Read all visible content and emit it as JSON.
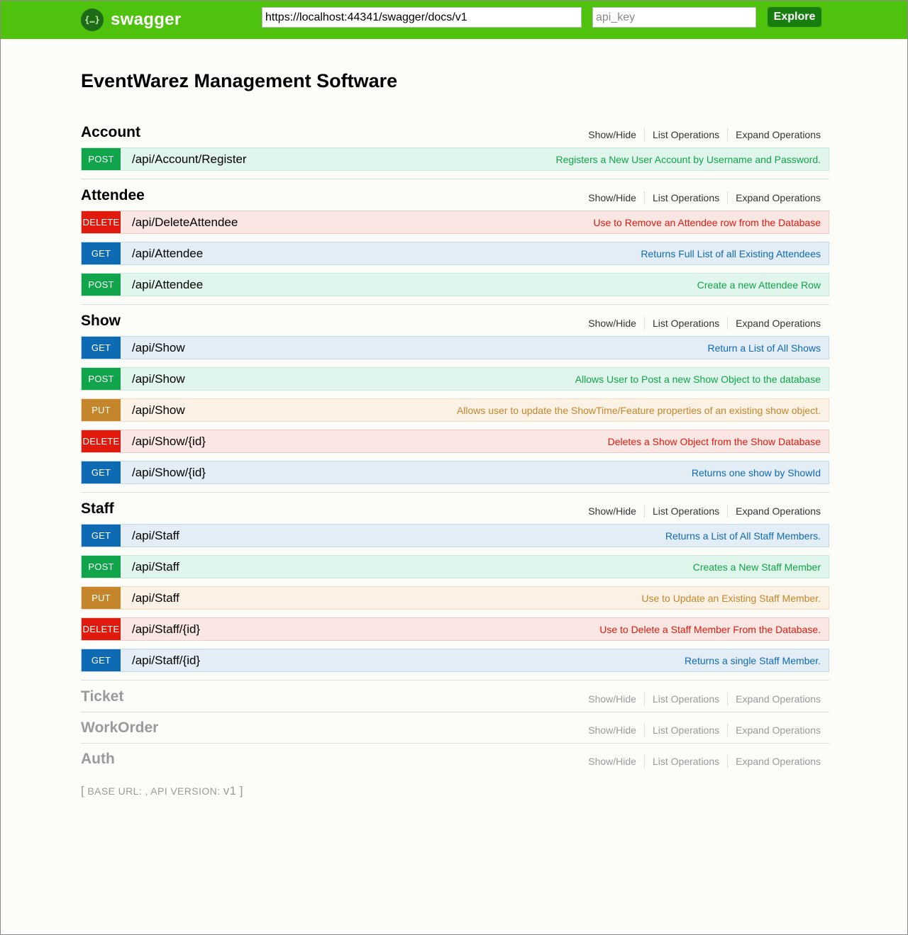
{
  "header": {
    "logo_text": "swagger",
    "logo_icon": "{…}",
    "url_value": "https://localhost:44341/swagger/docs/v1",
    "api_key_placeholder": "api_key",
    "explore_label": "Explore"
  },
  "title": "EventWarez Management Software",
  "links": {
    "show_hide": "Show/Hide",
    "list_ops": "List Operations",
    "expand_ops": "Expand Operations"
  },
  "resources": [
    {
      "name": "Account",
      "operations": [
        {
          "method": "POST",
          "path": "/api/Account/Register",
          "summary": "Registers a New User Account by Username and Password."
        }
      ]
    },
    {
      "name": "Attendee",
      "operations": [
        {
          "method": "DELETE",
          "path": "/api/DeleteAttendee",
          "summary": "Use to Remove an Attendee row from the Database"
        },
        {
          "method": "GET",
          "path": "/api/Attendee",
          "summary": "Returns Full List of all Existing Attendees"
        },
        {
          "method": "POST",
          "path": "/api/Attendee",
          "summary": "Create a new Attendee Row"
        }
      ]
    },
    {
      "name": "Show",
      "operations": [
        {
          "method": "GET",
          "path": "/api/Show",
          "summary": "Return a List of All Shows"
        },
        {
          "method": "POST",
          "path": "/api/Show",
          "summary": "Allows User to Post a new Show Object to the database"
        },
        {
          "method": "PUT",
          "path": "/api/Show",
          "summary": "Allows user to update the ShowTime/Feature properties of an existing show object."
        },
        {
          "method": "DELETE",
          "path": "/api/Show/{id}",
          "summary": "Deletes a Show Object from the Show Database"
        },
        {
          "method": "GET",
          "path": "/api/Show/{id}",
          "summary": "Returns one show by ShowId"
        }
      ]
    },
    {
      "name": "Staff",
      "operations": [
        {
          "method": "GET",
          "path": "/api/Staff",
          "summary": "Returns a List of All Staff Members."
        },
        {
          "method": "POST",
          "path": "/api/Staff",
          "summary": "Creates a New Staff Member"
        },
        {
          "method": "PUT",
          "path": "/api/Staff",
          "summary": "Use to Update an Existing Staff Member."
        },
        {
          "method": "DELETE",
          "path": "/api/Staff/{id}",
          "summary": "Use to Delete a Staff Member From the Database."
        },
        {
          "method": "GET",
          "path": "/api/Staff/{id}",
          "summary": "Returns a single Staff Member."
        }
      ]
    },
    {
      "name": "Ticket",
      "operations": []
    },
    {
      "name": "WorkOrder",
      "operations": []
    },
    {
      "name": "Auth",
      "operations": []
    }
  ],
  "footer": {
    "open_bracket": "[",
    "base_url_label": "BASE URL: ",
    "base_url_value": "",
    "sep": ", ",
    "api_version_label": "API VERSION: ",
    "api_version_value": "v1",
    "close_bracket": "]"
  },
  "colors": {
    "header_bg": "#4fc20d",
    "post": "#10a54a",
    "get": "#0f6ab4",
    "delete": "#e11a0e",
    "put": "#c5862b"
  }
}
